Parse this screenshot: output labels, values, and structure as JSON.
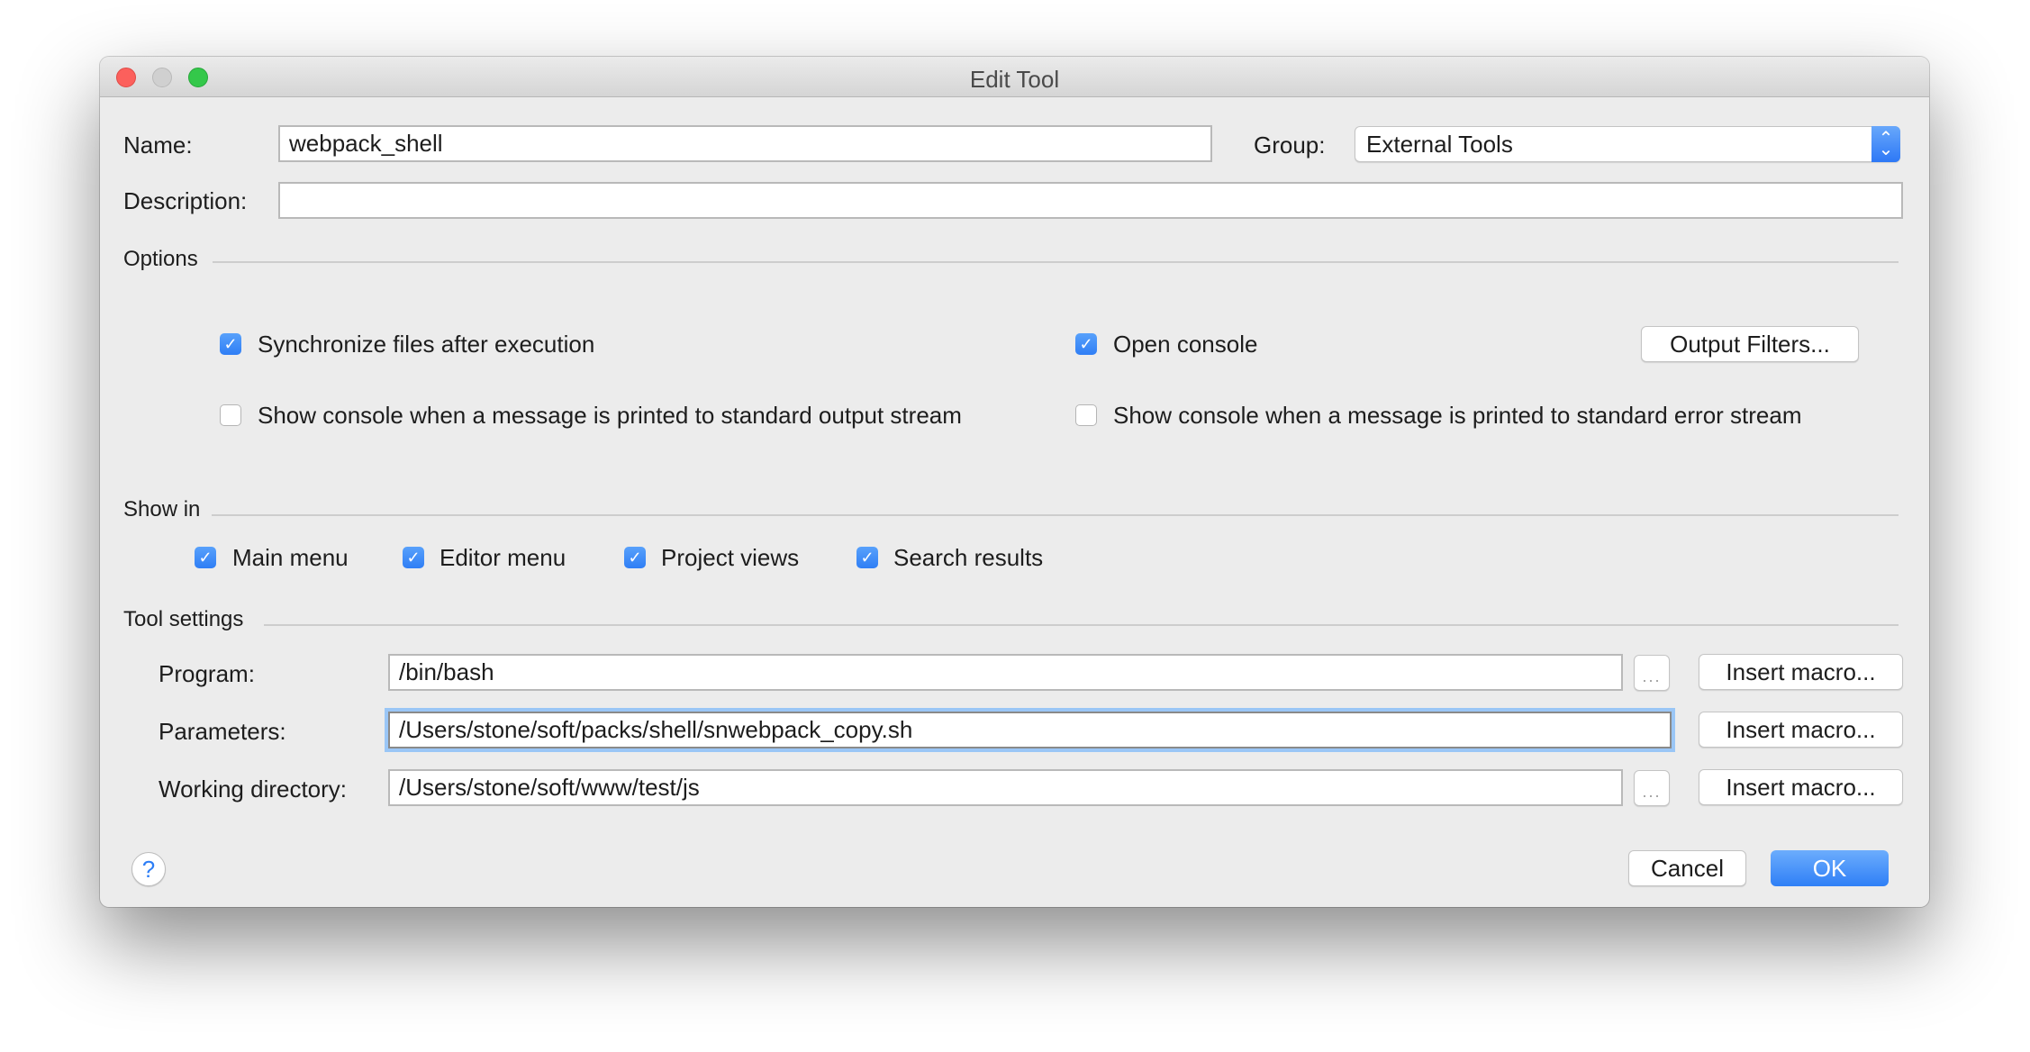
{
  "window": {
    "title": "Edit Tool"
  },
  "form": {
    "name_label": "Name:",
    "name_value": "webpack_shell",
    "group_label": "Group:",
    "group_value": "External Tools",
    "description_label": "Description:",
    "description_value": ""
  },
  "options": {
    "heading": "Options",
    "sync_files": {
      "label": "Synchronize files after execution",
      "checked": true
    },
    "open_console": {
      "label": "Open console",
      "checked": true
    },
    "output_filters_button": "Output Filters...",
    "show_console_stdout": {
      "label": "Show console when a message is printed to standard output stream",
      "checked": false
    },
    "show_console_stderr": {
      "label": "Show console when a message is printed to standard error stream",
      "checked": false
    }
  },
  "show_in": {
    "heading": "Show in",
    "items": [
      {
        "label": "Main menu",
        "checked": true
      },
      {
        "label": "Editor menu",
        "checked": true
      },
      {
        "label": "Project views",
        "checked": true
      },
      {
        "label": "Search results",
        "checked": true
      }
    ]
  },
  "tool_settings": {
    "heading": "Tool settings",
    "program": {
      "label": "Program:",
      "value": "/bin/bash"
    },
    "parameters": {
      "label": "Parameters:",
      "value": "/Users/stone/soft/packs/shell/snwebpack_copy.sh"
    },
    "working_directory": {
      "label": "Working directory:",
      "value": "/Users/stone/soft/www/test/js"
    },
    "browse_label": "...",
    "insert_macro_label": "Insert macro..."
  },
  "footer": {
    "help_label": "?",
    "cancel_label": "Cancel",
    "ok_label": "OK"
  },
  "icons": {
    "check": "✓",
    "select_up": "⌃",
    "select_down": "⌄"
  },
  "colors": {
    "accent": "#2f7ff6",
    "focus_ring": "#9ac6f6",
    "close": "#fc605c",
    "maximize": "#34c84a"
  }
}
